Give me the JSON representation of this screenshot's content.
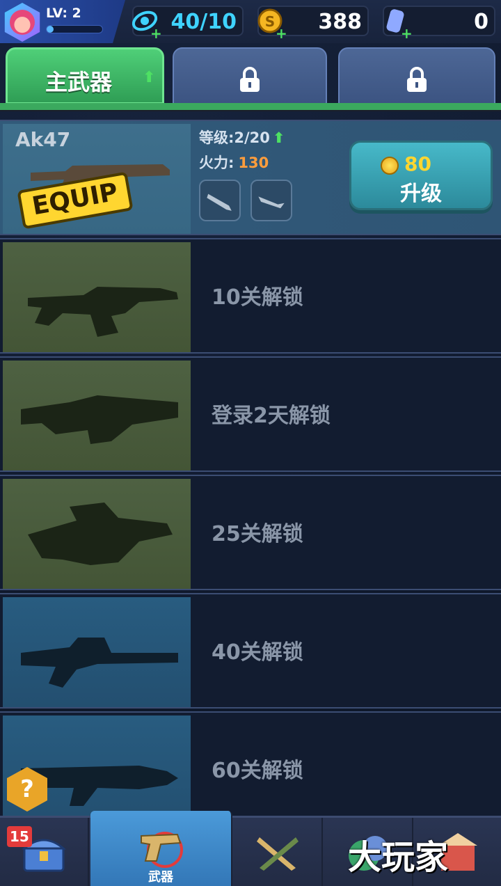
{
  "player": {
    "level_label": "LV: 2",
    "xp_fraction": 0.12
  },
  "resources": {
    "energy": {
      "icon": "energy-icon",
      "value": "40/10"
    },
    "coins": {
      "icon": "coin-icon",
      "value": "388"
    },
    "gems": {
      "icon": "gem-icon",
      "value": "0"
    }
  },
  "tabs": [
    {
      "label": "主武器",
      "locked": false,
      "active": true
    },
    {
      "label": "",
      "locked": true
    },
    {
      "label": "",
      "locked": true
    }
  ],
  "equipped": {
    "name": "Ak47",
    "badge": "EQUIP",
    "level_label": "等级:2/20",
    "fire_label": "火力:",
    "fire_value": "130",
    "upgrade_cost": "80",
    "upgrade_label": "升级"
  },
  "locked_weapons": [
    {
      "unlock": "10关解锁"
    },
    {
      "unlock": "登录2天解锁"
    },
    {
      "unlock": "25关解锁"
    },
    {
      "unlock": "40关解锁"
    },
    {
      "unlock": "60关解锁"
    }
  ],
  "help": {
    "label": "?"
  },
  "bottom_nav": {
    "chest_badge": "15",
    "weapons_label": "武器"
  },
  "watermark": "大玩家",
  "colors": {
    "accent_green": "#3ba95e",
    "cyan": "#3fd3ff",
    "gold": "#ffd630"
  }
}
